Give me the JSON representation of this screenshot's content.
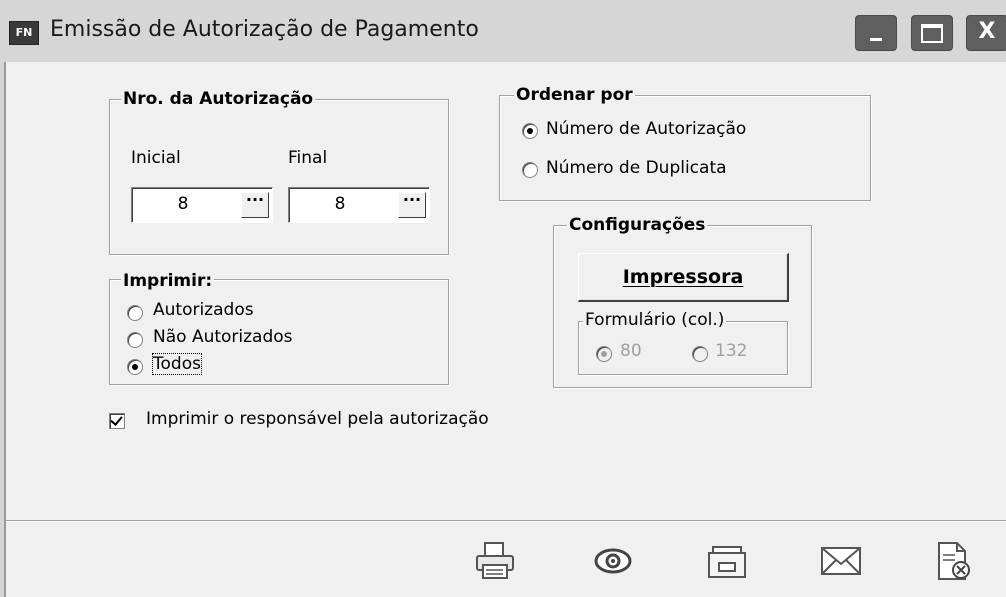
{
  "window": {
    "icon_label": "FN",
    "title": "Emissão de Autorização de Pagamento",
    "controls": {
      "minimize": "minimize",
      "maximize": "maximize",
      "close": "X"
    }
  },
  "nro_autorizacao": {
    "legend": "Nro. da Autorização",
    "inicial_label": "Inicial",
    "final_label": "Final",
    "inicial_value": "8",
    "final_value": "8",
    "lookup_label": "···"
  },
  "ordenar_por": {
    "legend": "Ordenar por",
    "options": [
      "Número de Autorização",
      "Número de Duplicata"
    ],
    "selected": "Número de Autorização"
  },
  "imprimir": {
    "legend": "Imprimir:",
    "options": [
      "Autorizados",
      "Não Autorizados",
      "Todos"
    ],
    "selected": "Todos"
  },
  "configuracoes": {
    "legend": "Configurações",
    "printer_button": "Impressora",
    "formulario": {
      "legend": "Formulário (col.)",
      "options": [
        "80",
        "132"
      ],
      "selected": "80"
    }
  },
  "responsavel_checkbox": {
    "label": "Imprimir o responsável pela autorização",
    "checked": true
  },
  "toolbar": {
    "icons": [
      "printer-icon",
      "preview-eye-icon",
      "folder-icon",
      "envelope-icon",
      "document-cancel-icon"
    ]
  }
}
